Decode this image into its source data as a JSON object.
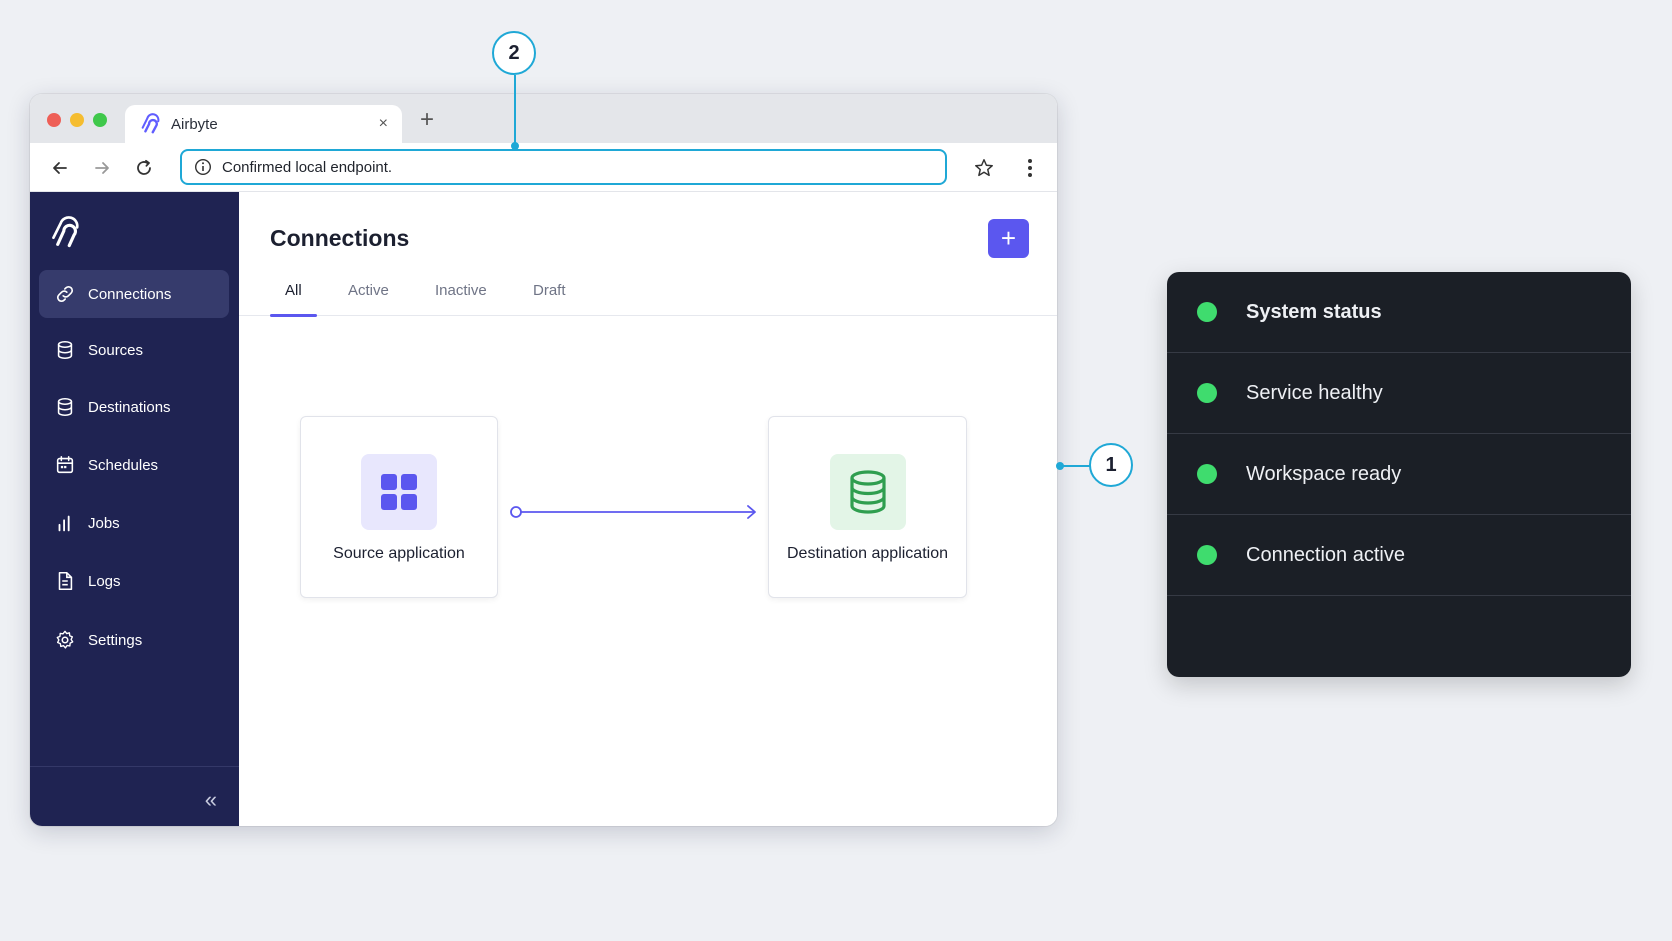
{
  "browser": {
    "tab_title": "Airbyte",
    "tab_close": "×",
    "new_tab": "+",
    "address_text": "Confirmed local endpoint."
  },
  "sidebar": {
    "items": [
      {
        "label": "Connections",
        "icon": "link-icon"
      },
      {
        "label": "Sources",
        "icon": "database-icon"
      },
      {
        "label": "Destinations",
        "icon": "database-icon"
      },
      {
        "label": "Schedules",
        "icon": "calendar-icon"
      },
      {
        "label": "Jobs",
        "icon": "bar-chart-icon"
      },
      {
        "label": "Logs",
        "icon": "document-icon"
      },
      {
        "label": "Settings",
        "icon": "gear-icon"
      }
    ],
    "collapse": "«"
  },
  "main": {
    "title": "Connections",
    "add_label": "+",
    "tabs": [
      "All",
      "Active",
      "Inactive",
      "Draft"
    ],
    "source_label": "Source application",
    "destination_label": "Destination application"
  },
  "callouts": [
    "1",
    "2"
  ],
  "status_panel": {
    "header": "System status",
    "items": [
      "Service healthy",
      "Workspace ready",
      "Connection active"
    ]
  },
  "colors": {
    "accent": "#5b57ef",
    "callout": "#1fa8d6",
    "status_ok": "#3fdc6e",
    "sidebar_bg": "#1f2352"
  }
}
